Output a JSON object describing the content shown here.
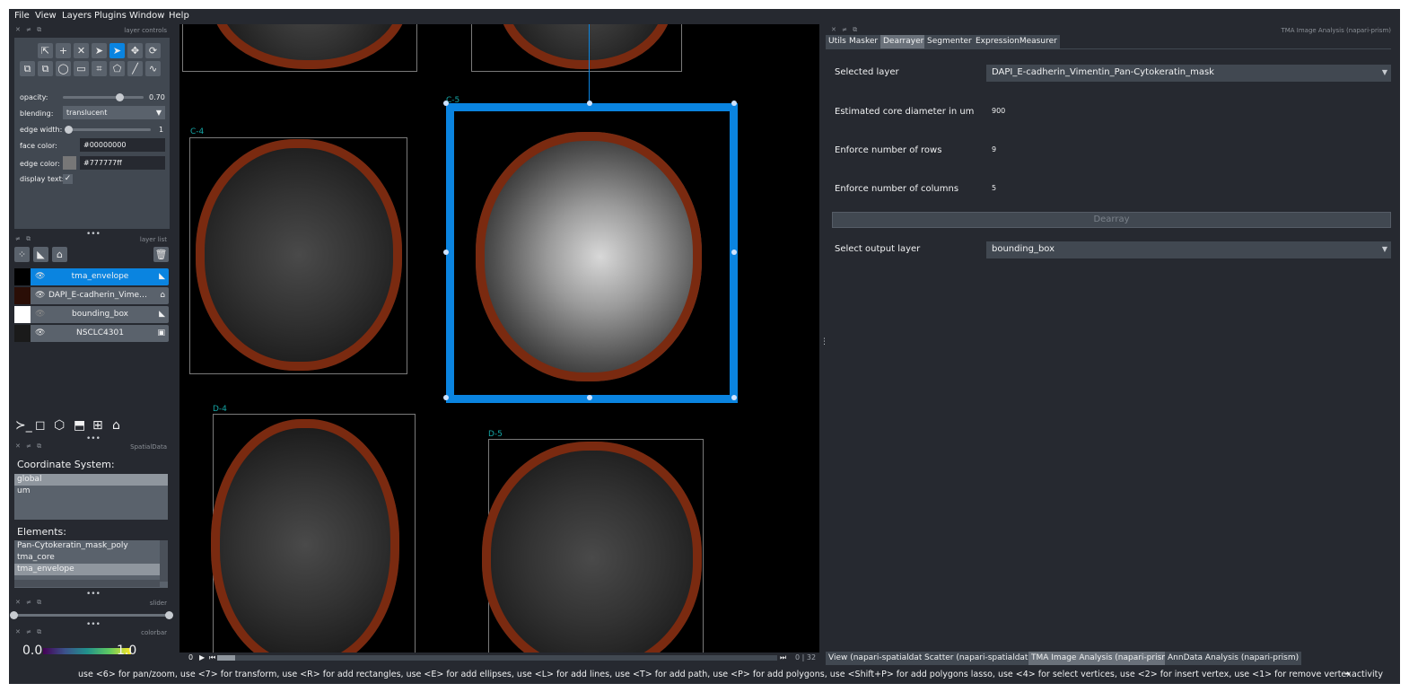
{
  "menu": [
    "File",
    "View",
    "Layers",
    "Plugins",
    "Window",
    "Help"
  ],
  "layer_controls": {
    "title": "layer controls",
    "opacity_label": "opacity:",
    "opacity_value": "0.70",
    "opacity_fraction": 0.7,
    "blending_label": "blending:",
    "blending_value": "translucent",
    "edge_width_label": "edge width:",
    "edge_width_value": "1",
    "face_color_label": "face color:",
    "face_color_value": "#00000000",
    "edge_color_label": "edge color:",
    "edge_color_value": "#777777ff",
    "display_text_label": "display text:",
    "display_text_checked": true
  },
  "layer_list": {
    "title": "layer list",
    "layers": [
      {
        "name": "tma_envelope",
        "selected": true,
        "visible": true
      },
      {
        "name": "DAPI_E-cadherin_Vimentin...",
        "selected": false,
        "visible": true
      },
      {
        "name": "bounding_box",
        "selected": false,
        "visible": false
      },
      {
        "name": "NSCLC4301",
        "selected": false,
        "visible": true
      }
    ]
  },
  "spatialdata": {
    "title": "SpatialData",
    "coord_label": "Coordinate System:",
    "coords": [
      {
        "name": "global",
        "selected": true
      },
      {
        "name": "um",
        "selected": false
      }
    ],
    "elements_label": "Elements:",
    "elements": [
      {
        "name": "Pan-Cytokeratin_mask_poly",
        "selected": false
      },
      {
        "name": "tma_core",
        "selected": false
      },
      {
        "name": "tma_envelope",
        "selected": true
      }
    ]
  },
  "slider_dock": {
    "title": "slider"
  },
  "colorbar": {
    "title": "colorbar",
    "min": "0.0",
    "max": "1.0"
  },
  "canvas": {
    "core_labels": [
      "C-4",
      "C-5",
      "D-4",
      "D-5"
    ],
    "frame_start": "0",
    "frame_counter": "0 | 32"
  },
  "right_panel": {
    "title": "TMA Image Analysis (napari-prism)",
    "tabs": [
      {
        "label": "Utils",
        "selected": false
      },
      {
        "label": "Masker",
        "selected": false
      },
      {
        "label": "Dearrayer",
        "selected": true
      },
      {
        "label": "Segmenter",
        "selected": false
      },
      {
        "label": "ExpressionMeasurer",
        "selected": false
      }
    ],
    "selected_layer_label": "Selected layer",
    "selected_layer_value": "DAPI_E-cadherin_Vimentin_Pan-Cytokeratin_mask",
    "core_diameter_label": "Estimated core diameter in um",
    "core_diameter_value": "900",
    "rows_label": "Enforce number of rows",
    "rows_value": "9",
    "cols_label": "Enforce number of columns",
    "cols_value": "5",
    "dearray_button": "Dearray",
    "output_layer_label": "Select output layer",
    "output_layer_value": "bounding_box"
  },
  "bottom_tabs": [
    {
      "label": "View (napari-spatialdata)",
      "selected": false
    },
    {
      "label": "Scatter (napari-spatialdata)",
      "selected": false
    },
    {
      "label": "TMA Image Analysis (napari-prism)",
      "selected": true
    },
    {
      "label": "AnnData Analysis (napari-prism)",
      "selected": false
    }
  ],
  "status_bar": {
    "hint": "use <6> for pan/zoom, use <7> for transform, use <R> for add rectangles, use <E> for add ellipses, use <L> for add lines, use <T> for add path, use <P> for add polygons, use <Shift+P> for add polygons lasso, use <4> for select vertices, use <2> for insert vertex, use <1> for remove vertex",
    "activity": "activity"
  },
  "colors": {
    "accent": "#0a84e0",
    "background": "#262930",
    "panel": "#414851",
    "envelope": "#7a2a10",
    "core_label": "#15a6a6"
  }
}
